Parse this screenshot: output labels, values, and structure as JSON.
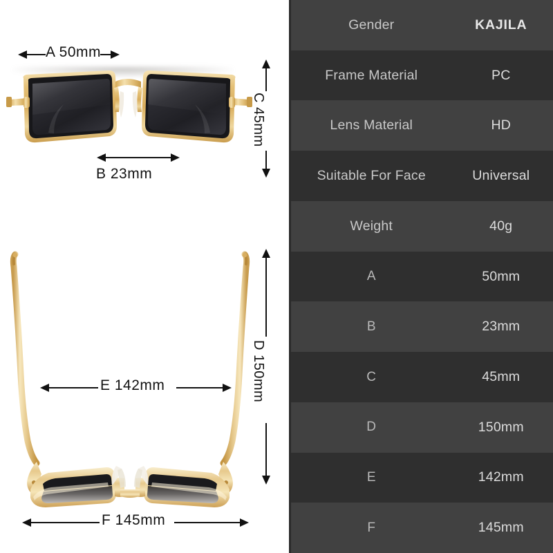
{
  "product": {
    "brand": "KAJILA",
    "type": "sunglasses-dimension-spec"
  },
  "spec_table": {
    "rows": [
      {
        "label": "Gender",
        "value": "KAJILA",
        "brand": true
      },
      {
        "label": "Frame Material",
        "value": "PC"
      },
      {
        "label": "Lens Material",
        "value": "HD"
      },
      {
        "label": "Suitable For Face",
        "value": "Universal"
      },
      {
        "label": "Weight",
        "value": "40g"
      },
      {
        "label": "A",
        "value": "50mm"
      },
      {
        "label": "B",
        "value": "23mm"
      },
      {
        "label": "C",
        "value": "45mm"
      },
      {
        "label": "D",
        "value": "150mm"
      },
      {
        "label": "E",
        "value": "142mm"
      },
      {
        "label": "F",
        "value": "145mm"
      }
    ]
  },
  "diagrams": {
    "front_view": {
      "name": "front-view-sunglasses",
      "dimensions": {
        "a": {
          "code": "A",
          "value": "50mm",
          "label": "A  50mm",
          "orientation": "horizontal",
          "position": "top"
        },
        "b": {
          "code": "B",
          "value": "23mm",
          "label": "B  23mm",
          "orientation": "horizontal",
          "position": "bottom"
        },
        "c": {
          "code": "C",
          "value": "45mm",
          "label": "C  45mm",
          "orientation": "vertical",
          "position": "right"
        }
      }
    },
    "folded_view": {
      "name": "folded-view-sunglasses",
      "dimensions": {
        "d": {
          "code": "D",
          "value": "150mm",
          "label": "D  150mm",
          "orientation": "vertical",
          "position": "right"
        },
        "e": {
          "code": "E",
          "value": "142mm",
          "label": "E  142mm",
          "orientation": "horizontal",
          "position": "middle"
        },
        "f": {
          "code": "F",
          "value": "145mm",
          "label": "F  145mm",
          "orientation": "horizontal",
          "position": "bottom"
        }
      }
    }
  },
  "colors": {
    "row_light": "#414141",
    "row_dark": "#2f2f2f",
    "label_text": "#c9c9c9",
    "value_text": "#dcdcdc",
    "frame_gold": "#e8c98a",
    "lens_dark": "#24242a",
    "background": "#ffffff"
  }
}
